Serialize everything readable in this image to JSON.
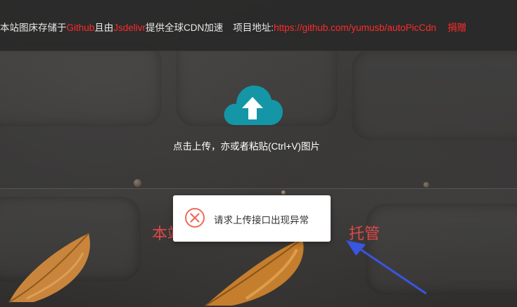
{
  "announcement": {
    "p1": "本站图床存储于",
    "github": "Github",
    "p2": "且由",
    "jsdelivr": "Jsdelivr",
    "p3": "提供全球CDN加速",
    "project_label": "项目地址:",
    "project_url": "https://github.com/yumusb/autoPicCdn",
    "donate": "捐赠"
  },
  "upload": {
    "hint": "点击上传，亦或者粘贴(Ctrl+V)图片",
    "icon": "cloud-upload-icon"
  },
  "notice_visible": {
    "left": "本站",
    "right": "托管"
  },
  "toast": {
    "message": "请求上传接口出现异常",
    "icon": "error-circle-icon"
  },
  "colors": {
    "accent": "#1496a6",
    "link_red": "#ff2a2a",
    "error_red": "#ef6b58"
  }
}
